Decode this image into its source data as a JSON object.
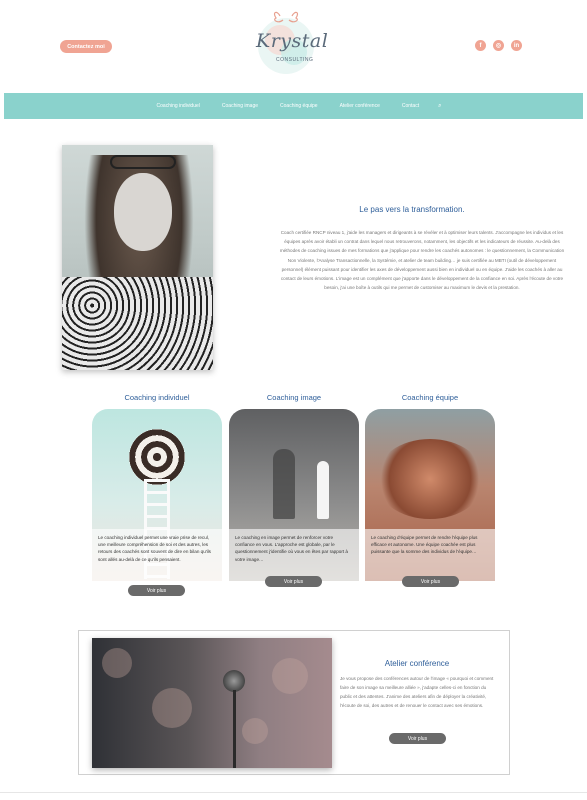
{
  "header": {
    "contact_label": "Contactez moi",
    "logo_script": "Krystal",
    "logo_sub": "CONSULTING",
    "socials": [
      {
        "icon": "facebook-icon",
        "glyph": "f"
      },
      {
        "icon": "instagram-icon",
        "glyph": "◎"
      },
      {
        "icon": "linkedin-icon",
        "glyph": "in"
      }
    ]
  },
  "nav": {
    "items": [
      "Coaching individuel",
      "Coaching image",
      "Coaching équipe",
      "Atelier conférence",
      "Contact"
    ],
    "search_icon": "⌕"
  },
  "intro": {
    "title": "Le pas vers la transformation.",
    "text": "Coach certifiée RNCP niveau 1, j'aide les managers et dirigeants à se révéler et à optimiser leurs talents. J'accompagne les individus et les équipes après avoir établi un contrat dans lequel nous retrouverons, notamment, les objectifs et les indicateurs de réussite. Au-delà des méthodes de coaching issues de mes formations que j'applique pour rendre les coachés autonomes : le questionnement, la Communication Non Violente, l'Analyse Transactionnelle, la Systémie, et atelier de team building… je suis certifiée au MBTI (outil de développement personnel) élément puissant pour identifier les axes de développement aussi bien en individuel ou en équipe. J'aide les coachés à aller au contact de leurs émotions. L'image est un complément que j'apporte dans le développement de la confiance en soi. Après l'écoute de votre besoin, j'ai une boîte à outils qui me permet de customiser au maximum le devis et la prestation."
  },
  "cards": [
    {
      "title": "Coaching individuel",
      "text": "Le coaching individuel permet une vraie prise de recul, une meilleure compréhension de soi et des autres, les retours des coachés sont souvent de dire en bilan qu'ils sont allés au-delà de ce qu'ils pensaient.",
      "button": "Voir plus"
    },
    {
      "title": "Coaching image",
      "text": "Le coaching en image permet de renforcer votre confiance en vous. L'approche est globale, par le questionnement j'identifie où vous en êtes par rapport à votre image…",
      "button": "Voir plus"
    },
    {
      "title": "Coaching équipe",
      "text": "Le coaching d'équipe permet de rendre l'équipe plus efficace et autonome. Une équipe coachée est plus puissante que la somme des individus de l'équipe…",
      "button": "Voir plus"
    }
  ],
  "conference": {
    "title": "Atelier conférence",
    "text": "Je vous propose des conférences autour de l'image « pourquoi et comment faire de son image sa meilleure alliée », j'adapte celles-ci en fonction du public et des attentes. J'anime des ateliers afin de déployer la créativité, l'écoute de soi, des autres et de renouer le contact avec ses émotions.",
    "button": "Voir plus"
  },
  "colors": {
    "accent": "#f0a493",
    "nav": "#8ad2cc",
    "title_blue": "#2f5f9a",
    "button_grey": "#6a6a6a"
  }
}
